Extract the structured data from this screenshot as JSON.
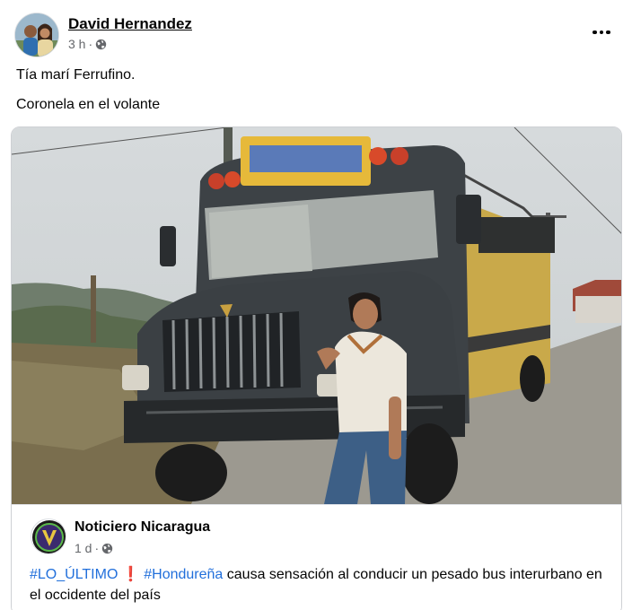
{
  "post": {
    "author": "David Hernandez",
    "time": "3 h",
    "audience_icon": "globe-icon",
    "more_icon": "more-horizontal-icon",
    "text_lines": [
      "Tía marí Ferrufino.",
      "Coronela en el volante"
    ]
  },
  "shared": {
    "page_name": "Noticiero Nicaragua",
    "time": "1 d",
    "audience_icon": "globe-icon",
    "hashtag1": "#LO_ÚLTIMO",
    "exclaim": "❗",
    "hashtag2": "#Hondureña",
    "text": "causa sensación al conducir un pesado bus interurbano en el occidente del país"
  },
  "colors": {
    "link": "#216fdb",
    "meta": "#65676b",
    "text": "#050505",
    "border": "#ced0d4"
  }
}
